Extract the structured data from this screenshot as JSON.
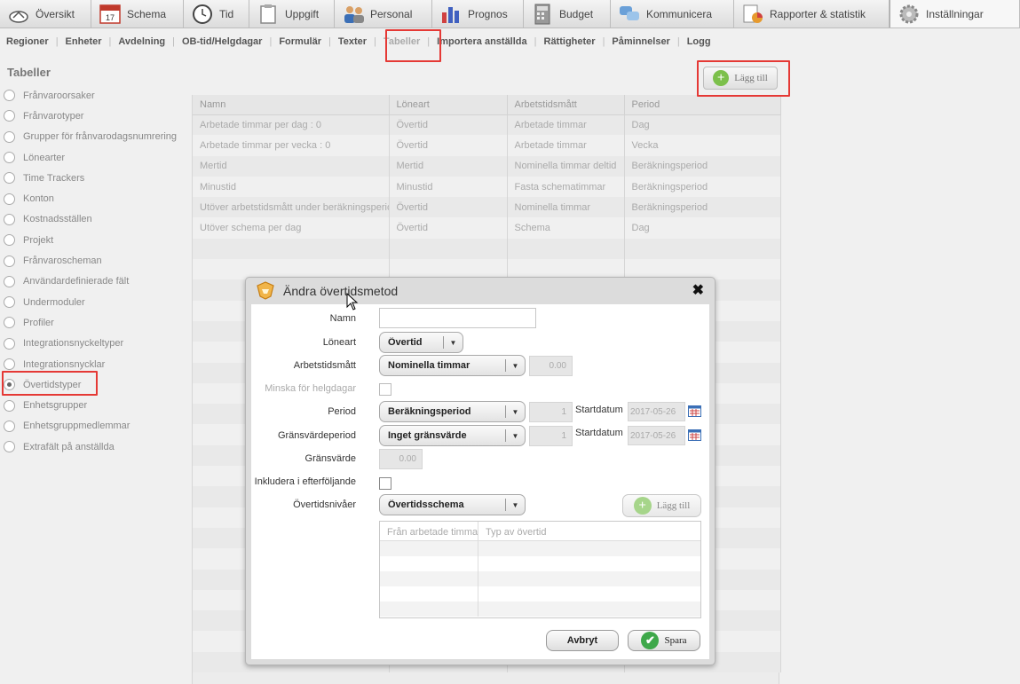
{
  "topnav": [
    {
      "label": "Översikt",
      "icon": "cloud-icon"
    },
    {
      "label": "Schema",
      "icon": "calendar-icon",
      "badge": "17"
    },
    {
      "label": "Tid",
      "icon": "clock-icon"
    },
    {
      "label": "Uppgift",
      "icon": "clipboard-icon"
    },
    {
      "label": "Personal",
      "icon": "people-icon"
    },
    {
      "label": "Prognos",
      "icon": "bar-chart-icon"
    },
    {
      "label": "Budget",
      "icon": "calculator-icon"
    },
    {
      "label": "Kommunicera",
      "icon": "chat-icon"
    },
    {
      "label": "Rapporter & statistik",
      "icon": "report-icon"
    },
    {
      "label": "Inställningar",
      "icon": "gear-icon",
      "active": true
    }
  ],
  "subnav": [
    {
      "label": "Regioner"
    },
    {
      "label": "Enheter"
    },
    {
      "label": "Avdelning"
    },
    {
      "label": "OB-tid/Helgdagar"
    },
    {
      "label": "Formulär"
    },
    {
      "label": "Texter"
    },
    {
      "label": "Tabeller",
      "active": true
    },
    {
      "label": "Importera anställda"
    },
    {
      "label": "Rättigheter"
    },
    {
      "label": "Påminnelser"
    },
    {
      "label": "Logg"
    }
  ],
  "sidebar": {
    "title": "Tabeller",
    "items": [
      {
        "label": "Frånvaroorsaker"
      },
      {
        "label": "Frånvarotyper"
      },
      {
        "label": "Grupper för frånvarodagsnumrering"
      },
      {
        "label": "Lönearter"
      },
      {
        "label": "Time Trackers"
      },
      {
        "label": "Konton"
      },
      {
        "label": "Kostnadsställen"
      },
      {
        "label": "Projekt"
      },
      {
        "label": "Frånvaroscheman"
      },
      {
        "label": "Användardefinierade fält"
      },
      {
        "label": "Undermoduler"
      },
      {
        "label": "Profiler"
      },
      {
        "label": "Integrationsnyckeltyper"
      },
      {
        "label": "Integrationsnycklar"
      },
      {
        "label": "Övertidstyper",
        "selected": true
      },
      {
        "label": "Enhetsgrupper"
      },
      {
        "label": "Enhetsgruppmedlemmar"
      },
      {
        "label": "Extrafält på anställda"
      }
    ]
  },
  "toolbar": {
    "add_label": "Lägg till"
  },
  "grid": {
    "columns": [
      "Namn",
      "Löneart",
      "Arbetstidsmått",
      "Period"
    ],
    "rows": [
      [
        "Arbetade timmar per dag : 0",
        "Övertid",
        "Arbetade timmar",
        "Dag"
      ],
      [
        "Arbetade timmar per vecka : 0",
        "Övertid",
        "Arbetade timmar",
        "Vecka"
      ],
      [
        "Mertid",
        "Mertid",
        "Nominella timmar deltid",
        "Beräkningsperiod"
      ],
      [
        "Minustid",
        "Minustid",
        "Fasta schematimmar",
        "Beräkningsperiod"
      ],
      [
        "Utöver arbetstidsmått under beräkningsperiod",
        "Övertid",
        "Nominella timmar",
        "Beräkningsperiod"
      ],
      [
        "Utöver schema per dag",
        "Övertid",
        "Schema",
        "Dag"
      ]
    ]
  },
  "dialog": {
    "title": "Ändra övertidsmetod",
    "close_glyph": "✖",
    "fields": {
      "namn": {
        "label": "Namn",
        "value": ""
      },
      "loneart": {
        "label": "Löneart",
        "value": "Övertid"
      },
      "arbetstidsmatt": {
        "label": "Arbetstidsmått",
        "value": "Nominella timmar",
        "amount": "0.00"
      },
      "minska": {
        "label": "Minska för helgdagar",
        "checked": false
      },
      "period": {
        "label": "Period",
        "value": "Beräkningsperiod",
        "count": "1",
        "start_label": "Startdatum",
        "start_date": "2017-05-26"
      },
      "gransvardeperiod": {
        "label": "Gränsvärdeperiod",
        "value": "Inget gränsvärde",
        "count": "1",
        "start_label": "Startdatum",
        "start_date": "2017-05-26"
      },
      "gransvarde": {
        "label": "Gränsvärde",
        "value": "0.00"
      },
      "inkludera": {
        "label": "Inkludera i efterföljande",
        "checked": false
      },
      "overtidsnivaer": {
        "label": "Övertidsnivåer",
        "value": "Övertidsschema"
      }
    },
    "levels_add_label": "Lägg till",
    "levels_columns": [
      "Från arbetade timmar",
      "Typ av övertid"
    ],
    "cancel_label": "Avbryt",
    "save_label": "Spara"
  },
  "colors": {
    "highlight": "#e53935",
    "add_green": "#7cc04b",
    "save_green": "#3ea84a"
  }
}
